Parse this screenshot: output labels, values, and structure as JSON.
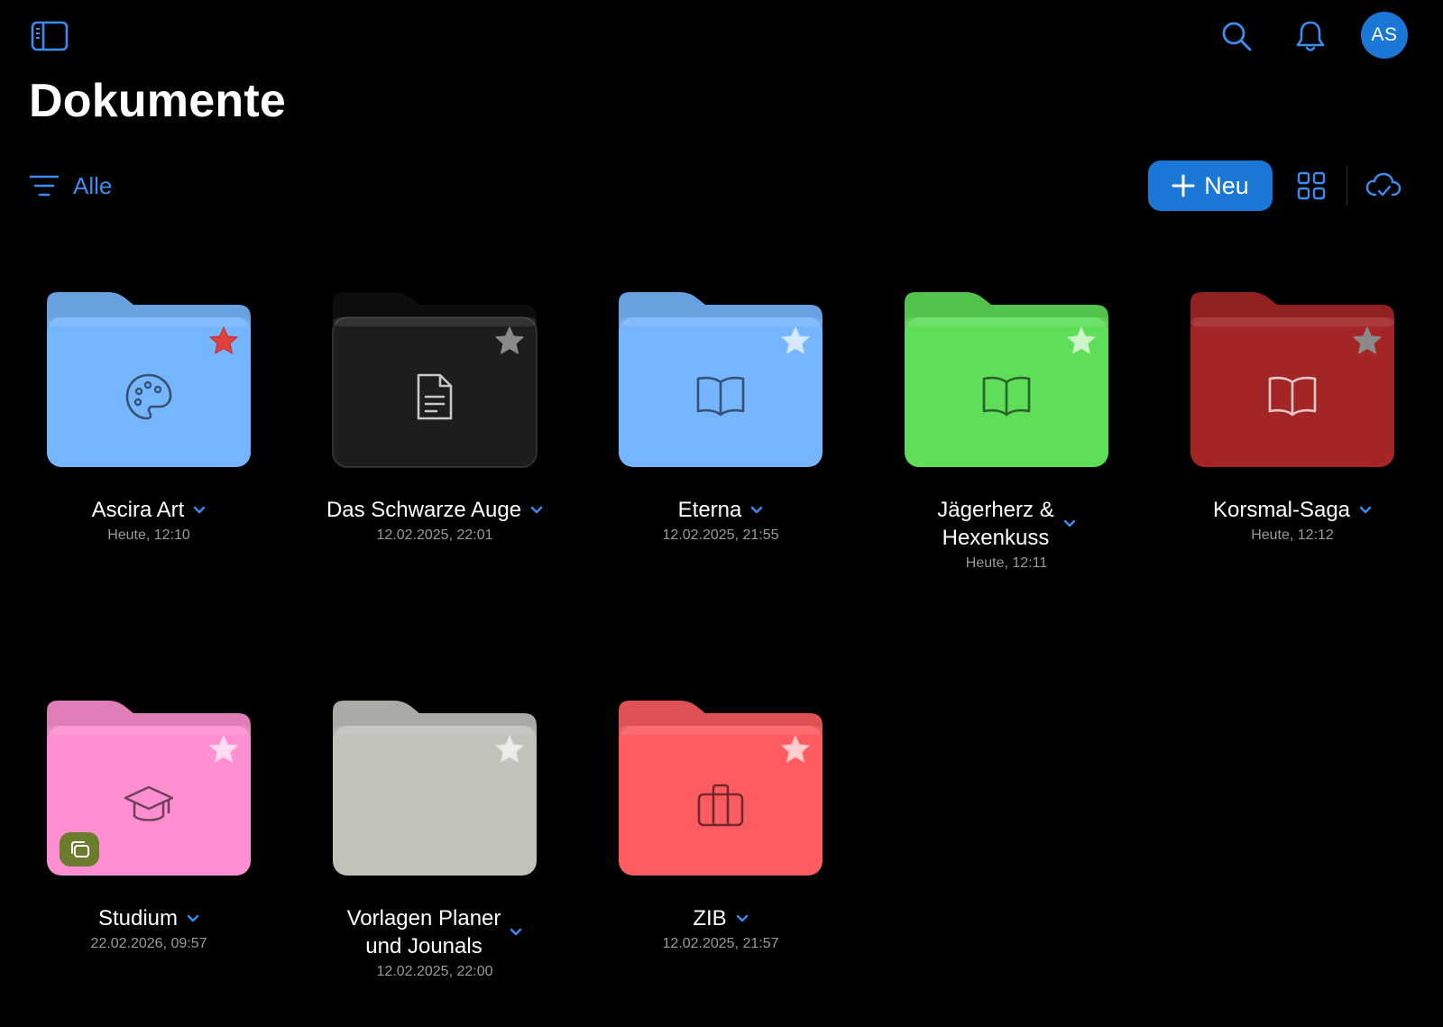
{
  "header": {
    "title": "Dokumente",
    "avatar_initials": "AS",
    "icons": [
      "sidebar-toggle-icon",
      "search-icon",
      "bell-icon"
    ]
  },
  "toolbar": {
    "filter_label": "Alle",
    "new_label": "Neu",
    "accent_color": "#1a77d6"
  },
  "folders": [
    {
      "name": "Ascira Art",
      "date": "Heute, 12:10",
      "color": "#76b6ff",
      "icon": "palette-icon",
      "favorite": true
    },
    {
      "name": "Das Schwarze Auge",
      "date": "12.02.2025, 22:01",
      "color": "#1e1c1d",
      "icon": "document-icon",
      "favorite": false
    },
    {
      "name": "Eterna",
      "date": "12.02.2025, 21:55",
      "color": "#76b6ff",
      "icon": "book-icon",
      "favorite": false
    },
    {
      "name": "Jägerherz & Hexenkuss",
      "name_line1": "Jägerherz &",
      "name_line2": "Hexenkuss",
      "date": "Heute, 12:11",
      "color": "#5ede59",
      "icon": "book-icon",
      "favorite": false
    },
    {
      "name": "Korsmal-Saga",
      "date": "Heute, 12:12",
      "color": "#a32525",
      "icon": "book-icon",
      "favorite": false
    },
    {
      "name": "Studium",
      "date": "22.02.2026, 09:57",
      "color": "#ff8fd0",
      "icon": "graduation-cap-icon",
      "favorite": false,
      "shared": true
    },
    {
      "name": "Vorlagen Planer und Jounals",
      "name_line1": "Vorlagen Planer",
      "name_line2": "und Jounals",
      "date": "12.02.2025, 22:00",
      "color": "#c2c1ba",
      "icon": "",
      "favorite": false
    },
    {
      "name": "ZIB",
      "date": "12.02.2025, 21:57",
      "color": "#ff5c61",
      "icon": "briefcase-icon",
      "favorite": false
    }
  ]
}
